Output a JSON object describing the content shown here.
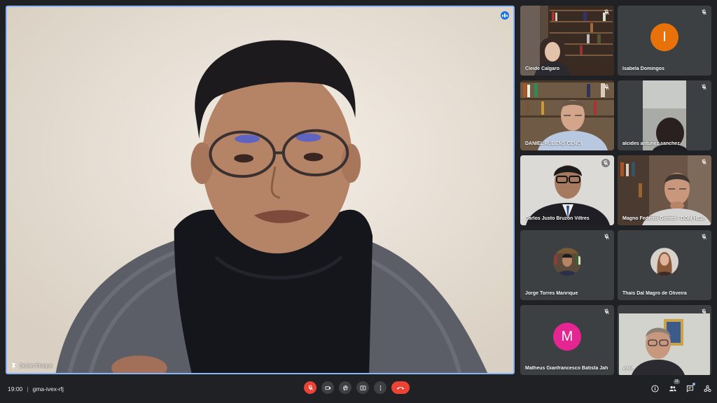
{
  "main_speaker": {
    "name": "Dorian Choque",
    "pinned": true,
    "speaking": true
  },
  "participants": [
    {
      "name": "Cleide Calgaro",
      "type": "video",
      "muted": true
    },
    {
      "name": "Isabela Domingos",
      "type": "avatar",
      "initial": "I",
      "avatar_color": "#e8710a",
      "muted": true
    },
    {
      "name": "DANIEL RUBENS CENCI",
      "type": "video",
      "muted": true
    },
    {
      "name": "alcides antunez sanchez",
      "type": "video",
      "muted": true
    },
    {
      "name": "Carlos Justo Bruzón Viltres",
      "type": "video",
      "muted": true
    },
    {
      "name": "Magno Federici Gomes - DOM HEL...",
      "type": "video",
      "muted": true
    },
    {
      "name": "Jorge Torres Manrique",
      "type": "photo-avatar",
      "muted": true
    },
    {
      "name": "Thaís Dal Magro de Oliveira",
      "type": "photo-avatar",
      "muted": true
    },
    {
      "name": "Matheus Gianfrancesco Batista Jahn",
      "type": "avatar",
      "initial": "M",
      "avatar_color": "#e52592",
      "muted": true
    },
    {
      "name": "Você",
      "type": "video",
      "muted": true
    }
  ],
  "bottom_bar": {
    "time": "19:00",
    "separator": "|",
    "meeting_code": "gma-ivex-rfj",
    "participant_count": "11"
  },
  "colors": {
    "background": "#202124",
    "tile": "#3c4043",
    "accent": "#8ab4f8",
    "danger": "#ea4335"
  },
  "icons": [
    "mic-off-icon",
    "camera-icon",
    "raise-hand-icon",
    "present-icon",
    "more-options-icon",
    "end-call-icon",
    "info-icon",
    "people-icon",
    "chat-icon",
    "activities-icon"
  ]
}
